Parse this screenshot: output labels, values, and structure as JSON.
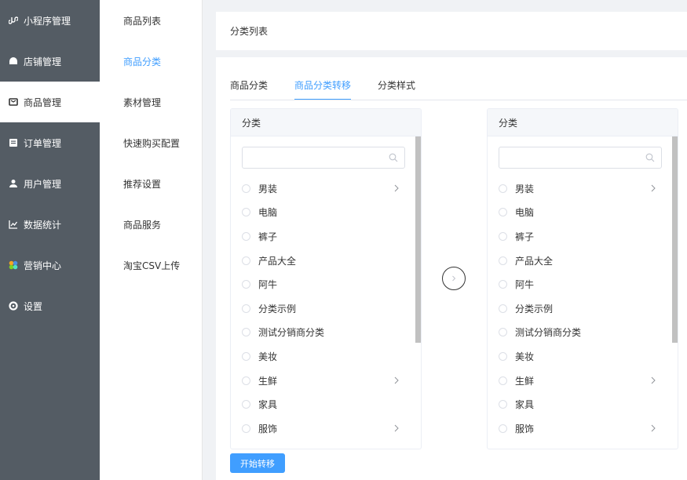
{
  "sidebar": {
    "items": [
      {
        "label": "小程序管理",
        "icon": "mini-program-icon"
      },
      {
        "label": "店铺管理",
        "icon": "shop-icon"
      },
      {
        "label": "商品管理",
        "icon": "product-icon",
        "active": true
      },
      {
        "label": "订单管理",
        "icon": "order-icon"
      },
      {
        "label": "用户管理",
        "icon": "user-icon"
      },
      {
        "label": "数据统计",
        "icon": "chart-icon"
      },
      {
        "label": "营销中心",
        "icon": "marketing-icon"
      },
      {
        "label": "设置",
        "icon": "settings-icon"
      }
    ]
  },
  "submenu": {
    "items": [
      {
        "label": "商品列表"
      },
      {
        "label": "商品分类",
        "active": true
      },
      {
        "label": "素材管理"
      },
      {
        "label": "快速购买配置"
      },
      {
        "label": "推荐设置"
      },
      {
        "label": "商品服务"
      },
      {
        "label": "淘宝CSV上传"
      }
    ]
  },
  "header": {
    "title": "分类列表"
  },
  "tabs": [
    {
      "label": "商品分类"
    },
    {
      "label": "商品分类转移",
      "active": true
    },
    {
      "label": "分类样式"
    }
  ],
  "left_panel": {
    "title": "分类",
    "search_placeholder": "",
    "items": [
      {
        "label": "男装",
        "has_children": true
      },
      {
        "label": "电脑",
        "has_children": false
      },
      {
        "label": "裤子",
        "has_children": false
      },
      {
        "label": "产品大全",
        "has_children": false
      },
      {
        "label": "阿牛",
        "has_children": false
      },
      {
        "label": "分类示例",
        "has_children": false
      },
      {
        "label": "测试分销商分类",
        "has_children": false
      },
      {
        "label": "美妆",
        "has_children": false
      },
      {
        "label": "生鲜",
        "has_children": true
      },
      {
        "label": "家具",
        "has_children": false
      },
      {
        "label": "服饰",
        "has_children": true
      }
    ]
  },
  "right_panel": {
    "title": "分类",
    "search_placeholder": "",
    "items": [
      {
        "label": "男装",
        "has_children": true
      },
      {
        "label": "电脑",
        "has_children": false
      },
      {
        "label": "裤子",
        "has_children": false
      },
      {
        "label": "产品大全",
        "has_children": false
      },
      {
        "label": "阿牛",
        "has_children": false
      },
      {
        "label": "分类示例",
        "has_children": false
      },
      {
        "label": "测试分销商分类",
        "has_children": false
      },
      {
        "label": "美妆",
        "has_children": false
      },
      {
        "label": "生鲜",
        "has_children": true
      },
      {
        "label": "家具",
        "has_children": false
      },
      {
        "label": "服饰",
        "has_children": true
      }
    ]
  },
  "actions": {
    "start_label": "开始转移"
  },
  "colors": {
    "sidebar_bg": "#545c64",
    "accent": "#409eff",
    "page_bg": "#f0f2f5"
  }
}
